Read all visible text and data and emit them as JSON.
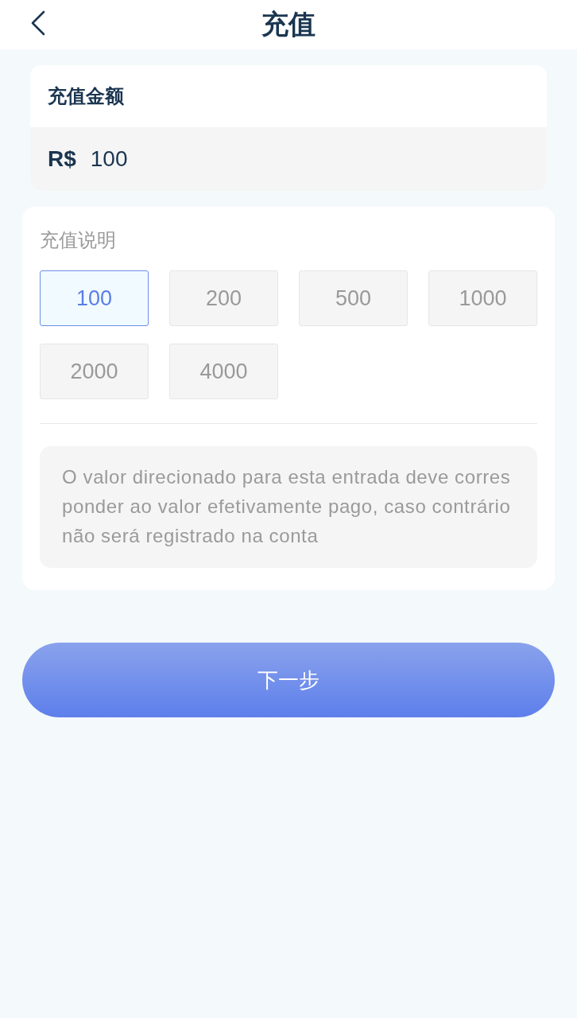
{
  "header": {
    "title": "充值"
  },
  "amount_card": {
    "title": "充值金额",
    "currency": "R$",
    "value": "100"
  },
  "options_card": {
    "title": "充值说明",
    "options": [
      {
        "label": "100",
        "selected": true
      },
      {
        "label": "200",
        "selected": false
      },
      {
        "label": "500",
        "selected": false
      },
      {
        "label": "1000",
        "selected": false
      },
      {
        "label": "2000",
        "selected": false
      },
      {
        "label": "4000",
        "selected": false
      }
    ],
    "note": "O valor direcionado para esta entrada deve corresponder ao valor efetivamente pago, caso contrário não será registrado na conta"
  },
  "next_button": "下一步"
}
